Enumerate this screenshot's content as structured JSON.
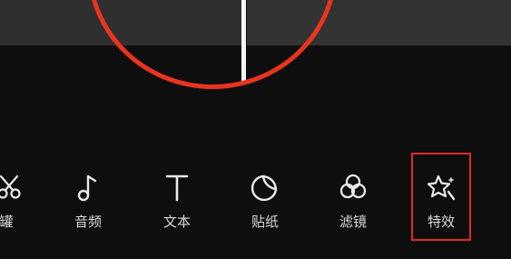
{
  "toolbar": {
    "items": [
      {
        "id": "canvas",
        "label": "罐",
        "icon": "scissors-icon"
      },
      {
        "id": "audio",
        "label": "音频",
        "icon": "music-note-icon"
      },
      {
        "id": "text",
        "label": "文本",
        "icon": "text-icon"
      },
      {
        "id": "sticker",
        "label": "贴纸",
        "icon": "sticker-icon"
      },
      {
        "id": "filter",
        "label": "滤镜",
        "icon": "filter-icon"
      },
      {
        "id": "effects",
        "label": "特效",
        "icon": "effects-star-icon"
      }
    ]
  },
  "colors": {
    "background": "#0e0e0e",
    "annotation": "#e9341f",
    "label": "#d9d9d9"
  }
}
